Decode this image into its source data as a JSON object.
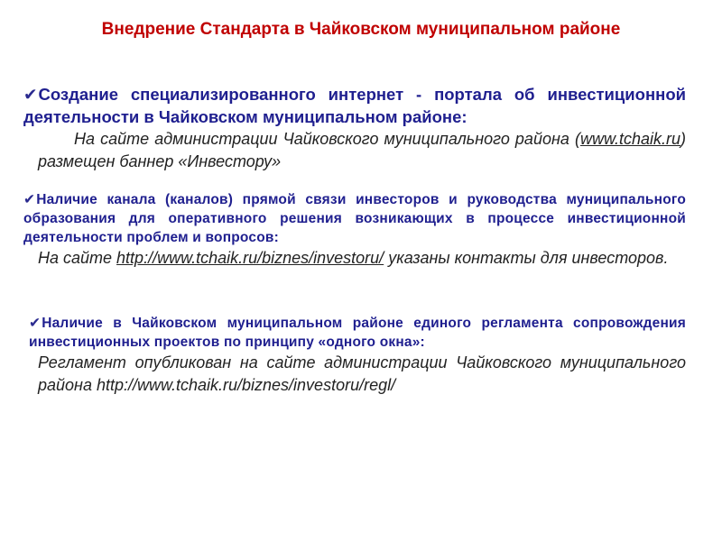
{
  "title": "Внедрение Стандарта в Чайковском муниципальном районе",
  "check_icon": "✔",
  "items": [
    {
      "heading": "Создание специализированного интернет - портала об инвестиционной деятельности в Чайковском муниципальном районе:",
      "body_pre": "На сайте администрации Чайковского муниципального района (",
      "link": "www.tchaik.ru",
      "body_post": ") размещен баннер «Инвестору»"
    },
    {
      "heading": "Наличие канала (каналов) прямой связи инвесторов и руководства муниципального образования для оперативного решения возникающих в процессе инвестиционной деятельности проблем и вопросов:",
      "body_pre": "На сайте ",
      "link": "http://www.tchaik.ru/biznes/investoru/",
      "body_post": "  указаны контакты для инвесторов."
    },
    {
      "heading": "Наличие в Чайковском муниципальном районе единого регламента сопровождения инвестиционных проектов по принципу «одного окна»:",
      "body": "Регламент опубликован на сайте администрации Чайковского муниципального района http://www.tchaik.ru/biznes/investoru/regl/"
    }
  ]
}
